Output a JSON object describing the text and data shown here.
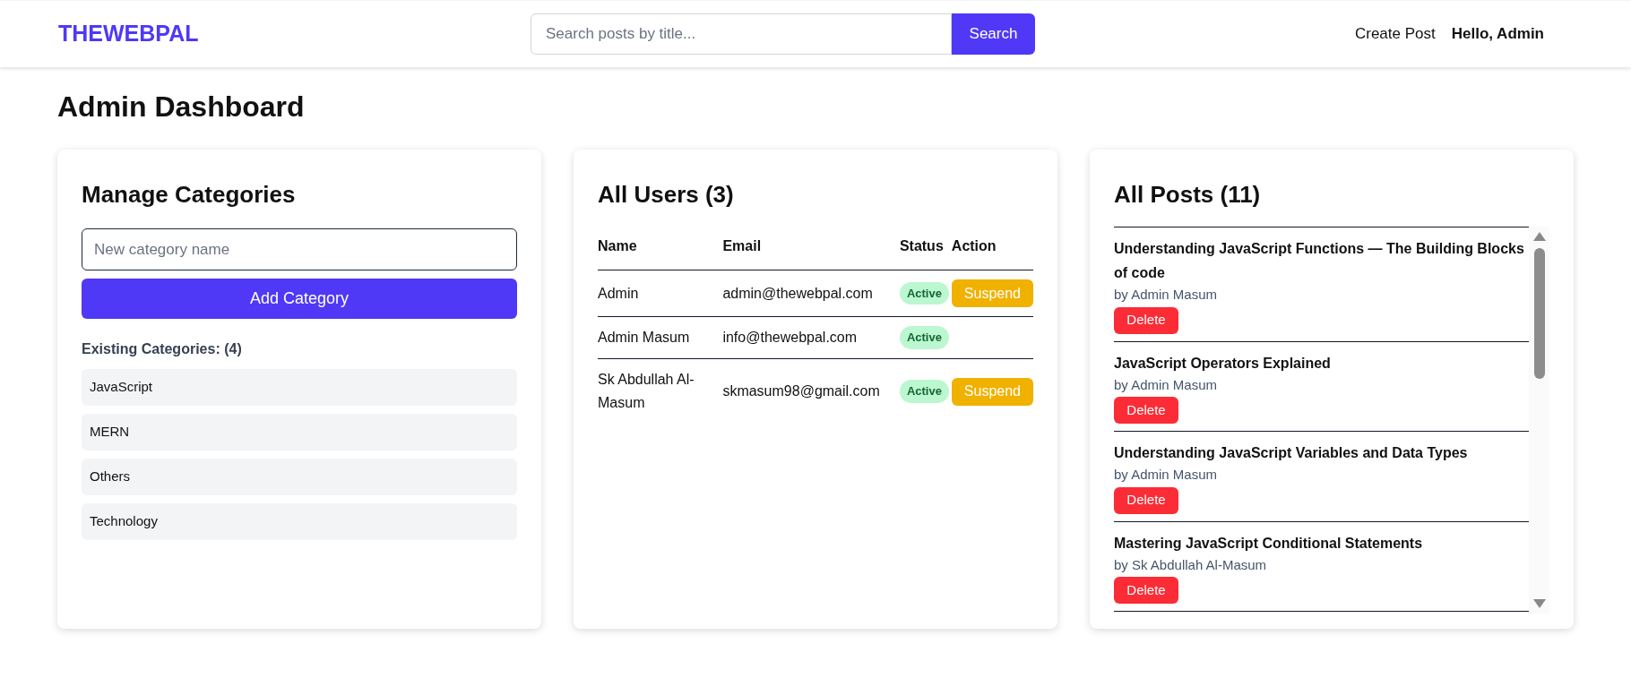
{
  "header": {
    "logo": "THEWEBPAL",
    "search": {
      "placeholder": "Search posts by title...",
      "button": "Search"
    },
    "nav": [
      {
        "label": "Create Post",
        "kind": "link"
      },
      {
        "label": "Hello, Admin",
        "kind": "greeting"
      }
    ]
  },
  "page_title": "Admin Dashboard",
  "categories": {
    "title": "Manage Categories",
    "input": {
      "placeholder": "New category name"
    },
    "button": "Add Category",
    "existing_label": "Existing Categories: (4)",
    "items": [
      "JavaScript",
      "MERN",
      "Others",
      "Technology"
    ]
  },
  "users": {
    "title": "All Users (3)",
    "columns": [
      "Name",
      "Email",
      "Status",
      "Action"
    ],
    "rows": [
      {
        "name": "Admin",
        "email": "admin@thewebpal.com",
        "status": "Active",
        "action": "Suspend"
      },
      {
        "name": "Admin Masum",
        "email": "info@thewebpal.com",
        "status": "Active"
      },
      {
        "name": "Sk Abdullah Al-Masum",
        "email": "skmasum98@gmail.com",
        "status": "Active",
        "action": "Suspend"
      }
    ]
  },
  "posts": {
    "title": "All Posts (11)",
    "items": [
      {
        "title": "Understanding JavaScript Functions — The Building Blocks of code",
        "author": "by Admin Masum",
        "button": "Delete"
      },
      {
        "title": "JavaScript Operators Explained",
        "author": "by Admin Masum",
        "button": "Delete"
      },
      {
        "title": "Understanding JavaScript Variables and Data Types",
        "author": "by Admin Masum",
        "button": "Delete"
      },
      {
        "title": "Mastering JavaScript Conditional Statements",
        "author": "by Sk Abdullah Al-Masum",
        "button": "Delete"
      }
    ]
  }
}
